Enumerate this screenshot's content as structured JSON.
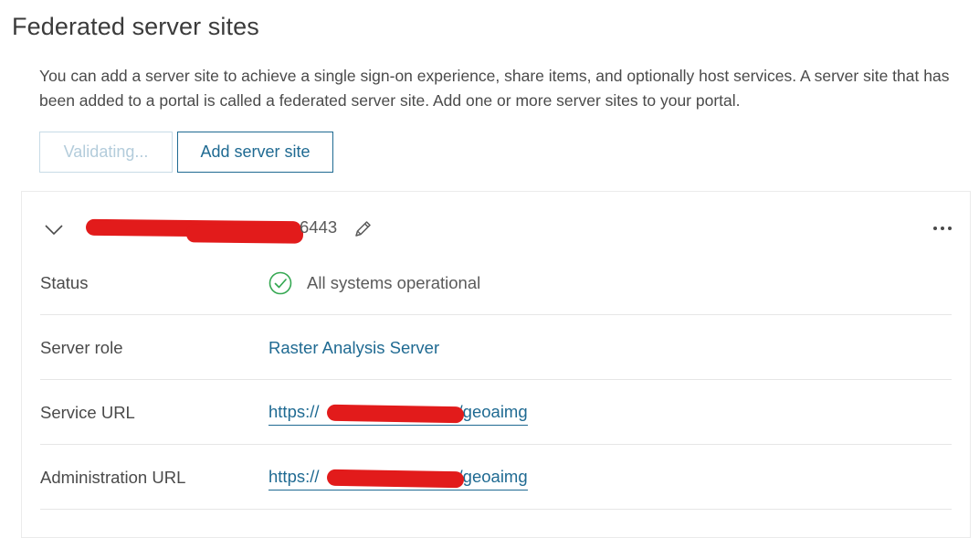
{
  "page": {
    "title": "Federated server sites",
    "description": "You can add a server site to achieve a single sign-on experience, share items, and optionally host services. A server site that has been added to a portal is called a federated server site. Add one or more server sites to your portal."
  },
  "buttons": {
    "validating_label": "Validating...",
    "add_server_site_label": "Add server site"
  },
  "site": {
    "name_visible_suffix": "6443",
    "icons": {
      "expand": "chevron-down-icon",
      "edit": "pencil-icon",
      "more": "more-options-icon",
      "status": "check-circle-icon"
    },
    "rows": [
      {
        "label": "Status",
        "value": "All systems operational"
      },
      {
        "label": "Server role",
        "value": "Raster Analysis Server"
      },
      {
        "label": "Service URL",
        "value_prefix": "https://",
        "value_suffix": "/geoaimg"
      },
      {
        "label": "Administration URL",
        "value_prefix": "https://",
        "value_suffix": "/geoaimg"
      }
    ]
  },
  "colors": {
    "accent": "#1f6a92",
    "success": "#35a852",
    "disabled_text": "#b3ccdb",
    "redaction": "#e21b1b"
  }
}
